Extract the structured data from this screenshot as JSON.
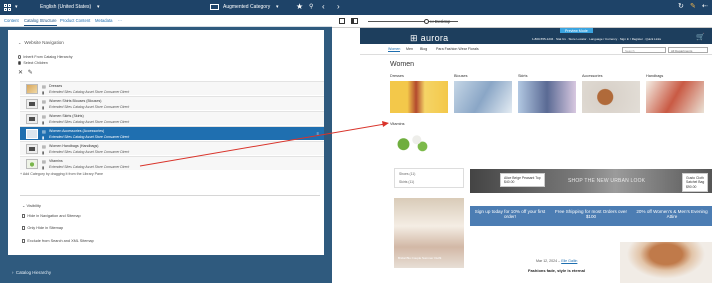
{
  "left_pane": {
    "topbar": {
      "locale": "English (United States)",
      "segment": "Augmented Category"
    },
    "tabs": [
      "Content",
      "Catalog Structure",
      "Product Content",
      "Metadata",
      "⋯"
    ],
    "website_navigation": {
      "heading": "Website Navigation",
      "inherit_label": "Inherit From Catalog Hierarchy",
      "select_label": "Select Children",
      "rows": [
        {
          "name": "Dresses",
          "catalog": "Extended Sites Catalog Asset Store Consumer Direct"
        },
        {
          "name": "Women Shirts Blouses (Blouses)",
          "catalog": "Extended Sites Catalog Asset Store Consumer Direct"
        },
        {
          "name": "Women Skirts (Skirts)",
          "catalog": "Extended Sites Catalog Asset Store Consumer Direct"
        },
        {
          "name": "Women Accessories (Accessories)",
          "catalog": "Extended Sites Catalog Asset Store Consumer Direct"
        },
        {
          "name": "Women Handbags (Handbags)",
          "catalog": "Extended Sites Catalog Asset Store Consumer Direct"
        },
        {
          "name": "Vitamins",
          "catalog": "Extended Sites Catalog Asset Store Consumer Direct"
        }
      ],
      "add_hint": "+ Add Category by dragging it from the Library Pane"
    },
    "visibility": {
      "heading": "Visibility",
      "options": [
        "Hide in Navigation and Sitemap",
        "Only Hide in Sitemap",
        "Exclude from Search and XML Sitemap"
      ]
    },
    "catalog_hierarchy": "Catalog Hierarchy"
  },
  "right_pane": {
    "toolbar": {
      "viewport_label": "Desktop"
    },
    "store": {
      "preview_mode": "Preview Mode",
      "brand": "aurora",
      "links": "1-800-555-1234 · Stat Us · Store Locator · Language / Currency · Sign In / Register · Quick Links",
      "nav": [
        "Women",
        "Men",
        "Blog",
        "Para Fashion Wear Florals"
      ],
      "search_placeholder": "Search",
      "dept_select": "All Departments",
      "women_heading": "Women",
      "categories": [
        "Dresses",
        "Blouses",
        "Skirts",
        "Accessories",
        "Handbags"
      ],
      "vitamins_heading": "Vitamins",
      "filters": [
        "Shoes (11)",
        "Skirts (11)"
      ],
      "hero_text": "SHOP THE NEW URBAN LOOK",
      "callout_left": [
        "Alice Beige Peasant Top",
        "$40.00"
      ],
      "callout_right": [
        "Gusto Cloth",
        "Satchel Bag",
        "$90.00"
      ],
      "banners": [
        "Sign up today for 10% off your first order!",
        "Free Shipping for most Orders over $100",
        "20% off Women's & Men's Evening Attire"
      ],
      "couple_caption": "Bridal Blu Couple Summer Outfit",
      "post_date": "Mar 12, 2024 – ",
      "post_author": "Elle Gallin",
      "post_title": "Fashions fade, style is eternal"
    }
  },
  "colors": {
    "nav_blue": "#1e4368",
    "selected_row": "#1f6fb0",
    "connector_red": "#d9342b",
    "banner_blue": "#4c7db3"
  }
}
